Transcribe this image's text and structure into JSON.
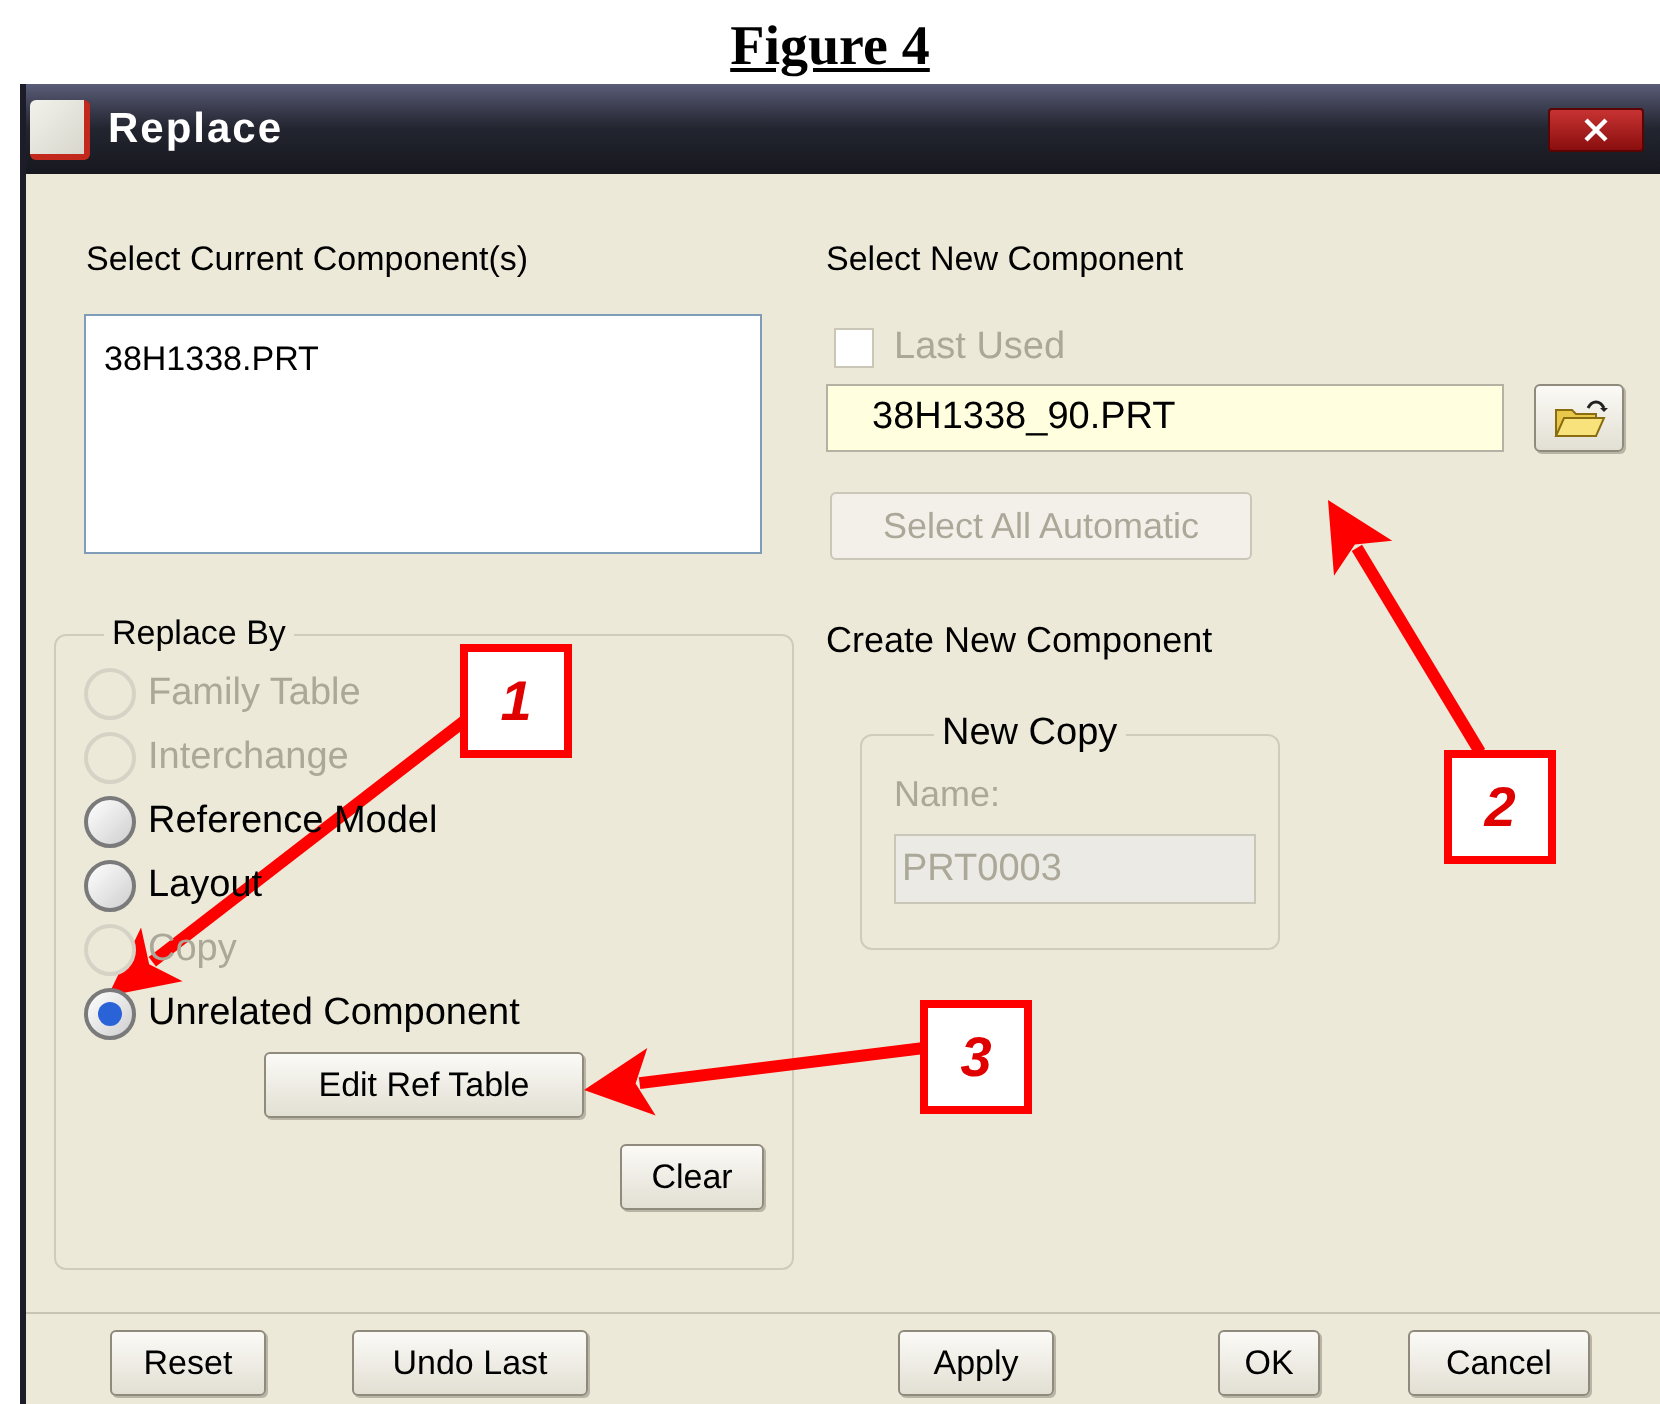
{
  "figure_title": "Figure 4",
  "window": {
    "title": "Replace"
  },
  "current_components": {
    "label": "Select Current Component(s)",
    "items": [
      {
        "text": "38H1338.PRT",
        "selected": false
      }
    ]
  },
  "replace_by": {
    "legend": "Replace By",
    "options": [
      {
        "label": "Family Table",
        "disabled": true,
        "selected": false
      },
      {
        "label": "Interchange",
        "disabled": true,
        "selected": false
      },
      {
        "label": "Reference Model",
        "disabled": false,
        "selected": false
      },
      {
        "label": "Layout",
        "disabled": false,
        "selected": false
      },
      {
        "label": "Copy",
        "disabled": true,
        "selected": false
      },
      {
        "label": "Unrelated Component",
        "disabled": false,
        "selected": true
      }
    ],
    "edit_button": "Edit Ref Table",
    "clear_button": "Clear"
  },
  "new_component": {
    "label": "Select New Component",
    "last_used": {
      "label": "Last Used",
      "checked": false,
      "disabled": true
    },
    "value": "38H1338_90.PRT",
    "select_all": {
      "label": "Select All Automatic",
      "disabled": true
    }
  },
  "create_new": {
    "label": "Create New Component",
    "legend": "New Copy",
    "name_label": "Name:",
    "name_value": "PRT0003",
    "disabled": true
  },
  "footer_buttons": [
    "Reset",
    "Undo Last",
    "Apply",
    "OK",
    "Cancel"
  ],
  "callouts": [
    "1",
    "2",
    "3"
  ]
}
